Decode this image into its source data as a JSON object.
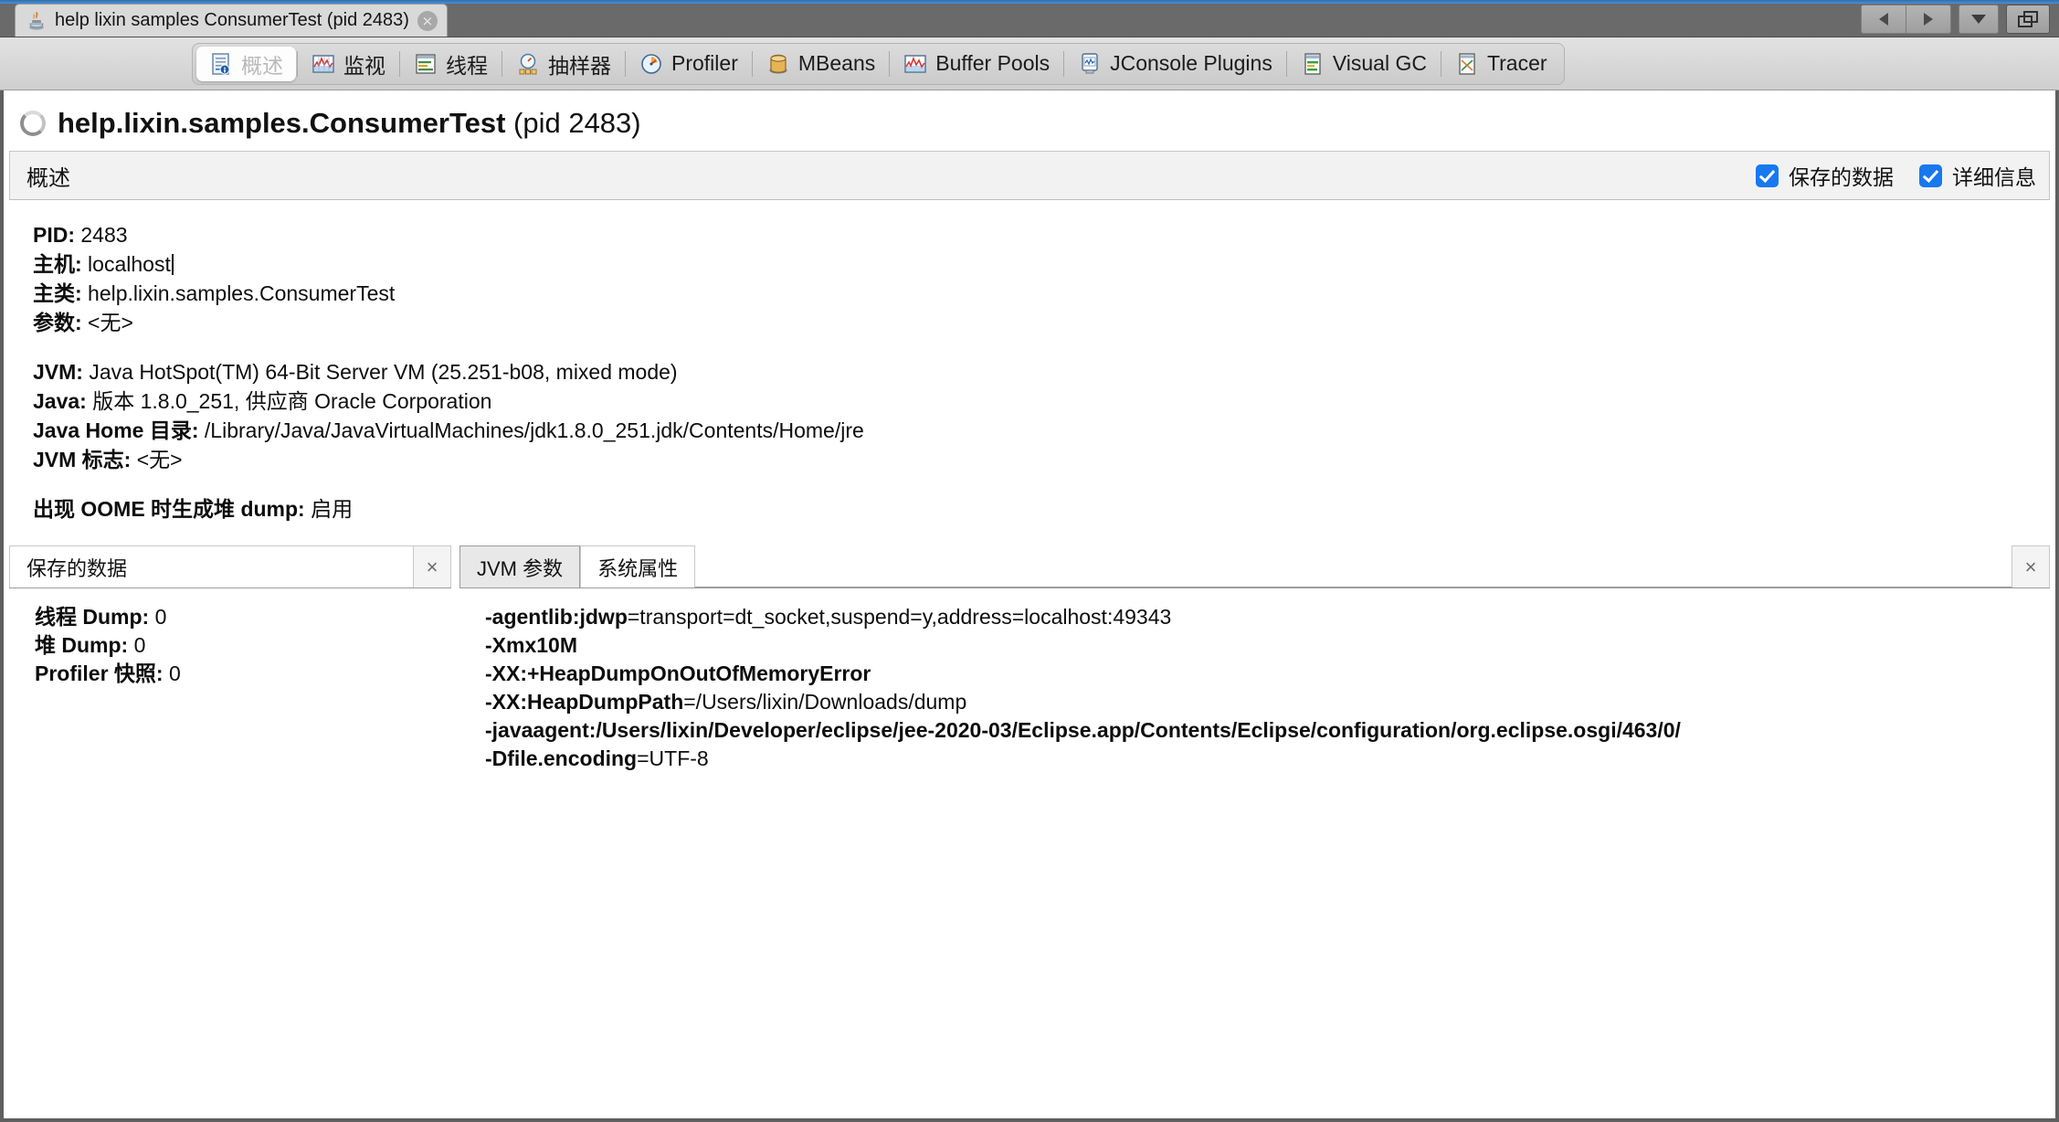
{
  "window": {
    "document_tab": {
      "label": "help lixin samples ConsumerTest (pid 2483)",
      "icon": "java-coffee-cup-icon",
      "close_label": "×"
    },
    "controls": {
      "back_label": "◀",
      "forward_label": "▶",
      "dropdown_label": "▼",
      "float_label": "⧉"
    }
  },
  "view_tabs": [
    {
      "label": "概述",
      "icon": "overview-document-icon",
      "selected": true
    },
    {
      "label": "监视",
      "icon": "monitor-chart-icon",
      "selected": false
    },
    {
      "label": "线程",
      "icon": "threads-icon",
      "selected": false
    },
    {
      "label": "抽样器",
      "icon": "sampler-gauge-icon",
      "selected": false
    },
    {
      "label": "Profiler",
      "icon": "profiler-clock-icon",
      "selected": false
    },
    {
      "label": "MBeans",
      "icon": "mbeans-icon",
      "selected": false
    },
    {
      "label": "Buffer Pools",
      "icon": "buffer-pools-icon",
      "selected": false
    },
    {
      "label": "JConsole Plugins",
      "icon": "jconsole-plugins-icon",
      "selected": false
    },
    {
      "label": "Visual GC",
      "icon": "visual-gc-icon",
      "selected": false
    },
    {
      "label": "Tracer",
      "icon": "tracer-icon",
      "selected": false
    }
  ],
  "app_header": {
    "icon": "loading-spinner-icon",
    "title_bold": "help.lixin.samples.ConsumerTest",
    "title_rest": " (pid 2483)"
  },
  "section": {
    "title": "概述",
    "checkboxes": [
      {
        "label": "保存的数据",
        "checked": true
      },
      {
        "label": "详细信息",
        "checked": true
      }
    ]
  },
  "overview": {
    "group1": [
      {
        "key": "PID:",
        "value": " 2483"
      },
      {
        "key": "主机:",
        "value": " localhost",
        "caret": true
      },
      {
        "key": "主类:",
        "value": " help.lixin.samples.ConsumerTest"
      },
      {
        "key": "参数:",
        "value": " <无>"
      }
    ],
    "group2": [
      {
        "key": "JVM:",
        "value": " Java HotSpot(TM) 64-Bit Server VM (25.251-b08, mixed mode)"
      },
      {
        "key": "Java:",
        "value": " 版本 1.8.0_251, 供应商 Oracle Corporation"
      },
      {
        "key": "Java Home 目录:",
        "value": " /Library/Java/JavaVirtualMachines/jdk1.8.0_251.jdk/Contents/Home/jre"
      },
      {
        "key": "JVM 标志:",
        "value": " <无>"
      }
    ],
    "group3": [
      {
        "key": "出现 OOME 时生成堆 dump:",
        "value": " 启用"
      }
    ]
  },
  "panel_left": {
    "tab_label": "保存的数据",
    "close_label": "×",
    "rows": [
      {
        "key": "线程 Dump:",
        "value": " 0"
      },
      {
        "key": "堆 Dump:",
        "value": " 0"
      },
      {
        "key": "Profiler 快照:",
        "value": " 0"
      }
    ]
  },
  "panel_right": {
    "tabs": [
      {
        "label": "JVM 参数",
        "active": true
      },
      {
        "label": "系统属性",
        "active": false
      }
    ],
    "close_label": "×",
    "jvm_arguments": [
      {
        "flag": "-agentlib:jdwp",
        "value": "=transport=dt_socket,suspend=y,address=localhost:49343"
      },
      {
        "flag": "-Xmx10M",
        "value": ""
      },
      {
        "flag": "-XX:+HeapDumpOnOutOfMemoryError",
        "value": ""
      },
      {
        "flag": "-XX:HeapDumpPath",
        "value": "=/Users/lixin/Downloads/dump"
      },
      {
        "flag": "-javaagent:/Users/lixin/Developer/eclipse/jee-2020-03/Eclipse.app/Contents/Eclipse/configuration/org.eclipse.osgi/463/0/",
        "value": ""
      },
      {
        "flag": "-Dfile.encoding",
        "value": "=UTF-8"
      }
    ]
  },
  "colors": {
    "accent_blue": "#1878f0",
    "title_bar": "#6a6a6a",
    "toolbar": "#d4d4d4",
    "panel_bg": "#ffffff"
  }
}
